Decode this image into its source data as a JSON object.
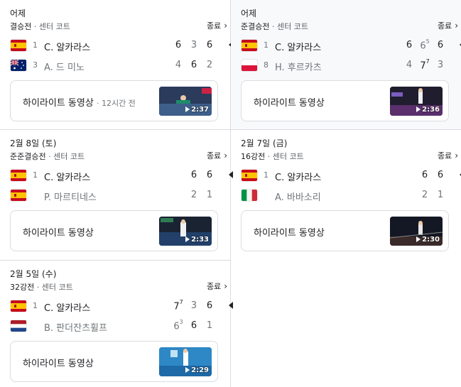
{
  "matches": [
    {
      "date": "어제",
      "round": "결승전",
      "venue": "· 센터 코트",
      "status": "종료",
      "players": [
        {
          "flag": "spain",
          "seed": "1",
          "name": "C. 알카라스",
          "sets": [
            {
              "v": "6",
              "sup": ""
            },
            {
              "v": "3",
              "sup": ""
            },
            {
              "v": "6",
              "sup": ""
            }
          ],
          "won": [
            true,
            false,
            true
          ],
          "winner": true
        },
        {
          "flag": "australia",
          "seed": "3",
          "name": "A. 드 미노",
          "sets": [
            {
              "v": "4",
              "sup": ""
            },
            {
              "v": "6",
              "sup": ""
            },
            {
              "v": "2",
              "sup": ""
            }
          ],
          "won": [
            false,
            true,
            false
          ],
          "winner": false
        }
      ],
      "highlight": {
        "label": "하이라이트 동영상",
        "time": "· 12시간 전",
        "duration": "2:37"
      }
    },
    {
      "date": "어제",
      "round": "준결승전",
      "venue": "· 센터 코트",
      "status": "종료",
      "players": [
        {
          "flag": "spain",
          "seed": "1",
          "name": "C. 알카라스",
          "sets": [
            {
              "v": "6",
              "sup": ""
            },
            {
              "v": "6",
              "sup": "5"
            },
            {
              "v": "6",
              "sup": ""
            }
          ],
          "won": [
            true,
            false,
            true
          ],
          "winner": true
        },
        {
          "flag": "poland",
          "seed": "8",
          "name": "H. 후르카츠",
          "sets": [
            {
              "v": "4",
              "sup": ""
            },
            {
              "v": "7",
              "sup": "7"
            },
            {
              "v": "3",
              "sup": ""
            }
          ],
          "won": [
            false,
            true,
            false
          ],
          "winner": false
        }
      ],
      "highlight": {
        "label": "하이라이트 동영상",
        "time": "",
        "duration": "2:36"
      }
    },
    {
      "date": "2월 8일 (토)",
      "round": "준준결승전",
      "venue": "· 센터 코트",
      "status": "종료",
      "players": [
        {
          "flag": "spain",
          "seed": "1",
          "name": "C. 알카라스",
          "sets": [
            {
              "v": "6",
              "sup": ""
            },
            {
              "v": "6",
              "sup": ""
            }
          ],
          "won": [
            true,
            true
          ],
          "winner": true
        },
        {
          "flag": "spain",
          "seed": "",
          "name": "P. 마르티네스",
          "sets": [
            {
              "v": "2",
              "sup": ""
            },
            {
              "v": "1",
              "sup": ""
            }
          ],
          "won": [
            false,
            false
          ],
          "winner": false
        }
      ],
      "highlight": {
        "label": "하이라이트 동영상",
        "time": "",
        "duration": "2:33"
      }
    },
    {
      "date": "2월 7일 (금)",
      "round": "16강전",
      "venue": "· 센터 코트",
      "status": "종료",
      "players": [
        {
          "flag": "spain",
          "seed": "1",
          "name": "C. 알카라스",
          "sets": [
            {
              "v": "6",
              "sup": ""
            },
            {
              "v": "6",
              "sup": ""
            }
          ],
          "won": [
            true,
            true
          ],
          "winner": true
        },
        {
          "flag": "italy",
          "seed": "",
          "name": "A. 바바소리",
          "sets": [
            {
              "v": "2",
              "sup": ""
            },
            {
              "v": "1",
              "sup": ""
            }
          ],
          "won": [
            false,
            false
          ],
          "winner": false
        }
      ],
      "highlight": {
        "label": "하이라이트 동영상",
        "time": "",
        "duration": "2:30"
      }
    },
    {
      "date": "2월 5일 (수)",
      "round": "32강전",
      "venue": "· 센터 코트",
      "status": "종료",
      "players": [
        {
          "flag": "spain",
          "seed": "1",
          "name": "C. 알카라스",
          "sets": [
            {
              "v": "7",
              "sup": "7"
            },
            {
              "v": "3",
              "sup": ""
            },
            {
              "v": "6",
              "sup": ""
            }
          ],
          "won": [
            true,
            false,
            true
          ],
          "winner": true
        },
        {
          "flag": "netherlands",
          "seed": "",
          "name": "B. 판더잔츠휠프",
          "sets": [
            {
              "v": "6",
              "sup": "3"
            },
            {
              "v": "6",
              "sup": ""
            },
            {
              "v": "1",
              "sup": ""
            }
          ],
          "won": [
            false,
            true,
            false
          ],
          "winner": false
        }
      ],
      "highlight": {
        "label": "하이라이트 동영상",
        "time": "",
        "duration": "2:29"
      }
    }
  ],
  "colors": {
    "divider": "#dadce0",
    "shaded_bg": "#f8f9fa",
    "muted_text": "#70757a"
  }
}
